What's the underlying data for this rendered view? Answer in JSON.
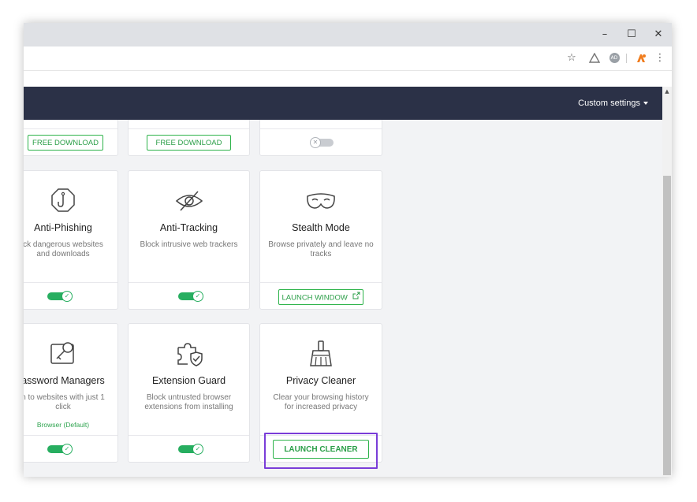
{
  "window": {
    "minimize": "–",
    "maximize": "☐",
    "close": "✕"
  },
  "toolbar": {
    "bookmark_icon": "star-icon",
    "extension1_icon": "warning-triangle-icon",
    "extension2_icon": "ad-badge-icon",
    "extension2_label": "AD",
    "avast_icon": "avast-logo-icon",
    "menu_icon": "kebab-menu-icon"
  },
  "header": {
    "custom_settings": "Custom settings"
  },
  "top_row": {
    "card1_button": "FREE DOWNLOAD",
    "card2_button": "FREE DOWNLOAD",
    "card3_toggle": "off"
  },
  "row2": {
    "anti_phishing": {
      "title": "Anti-Phishing",
      "desc": "ck dangerous websites and downloads",
      "toggle": "on"
    },
    "anti_tracking": {
      "title": "Anti-Tracking",
      "desc": "Block intrusive web trackers",
      "toggle": "on"
    },
    "stealth_mode": {
      "title": "Stealth Mode",
      "desc": "Browse privately and leave no tracks",
      "button": "LAUNCH WINDOW"
    }
  },
  "row3": {
    "password_managers": {
      "title": "assword Managers",
      "desc": "n to websites with just 1 click",
      "note": "Browser (Default)",
      "toggle": "on"
    },
    "extension_guard": {
      "title": "Extension Guard",
      "desc": "Block untrusted browser extensions from installing",
      "toggle": "on"
    },
    "privacy_cleaner": {
      "title": "Privacy Cleaner",
      "desc": "Clear your browsing history for increased privacy",
      "button": "LAUNCH CLEANER"
    }
  },
  "colors": {
    "header_bg": "#2b3147",
    "accent_green": "#27ae60",
    "highlight": "#7a3dd8"
  }
}
